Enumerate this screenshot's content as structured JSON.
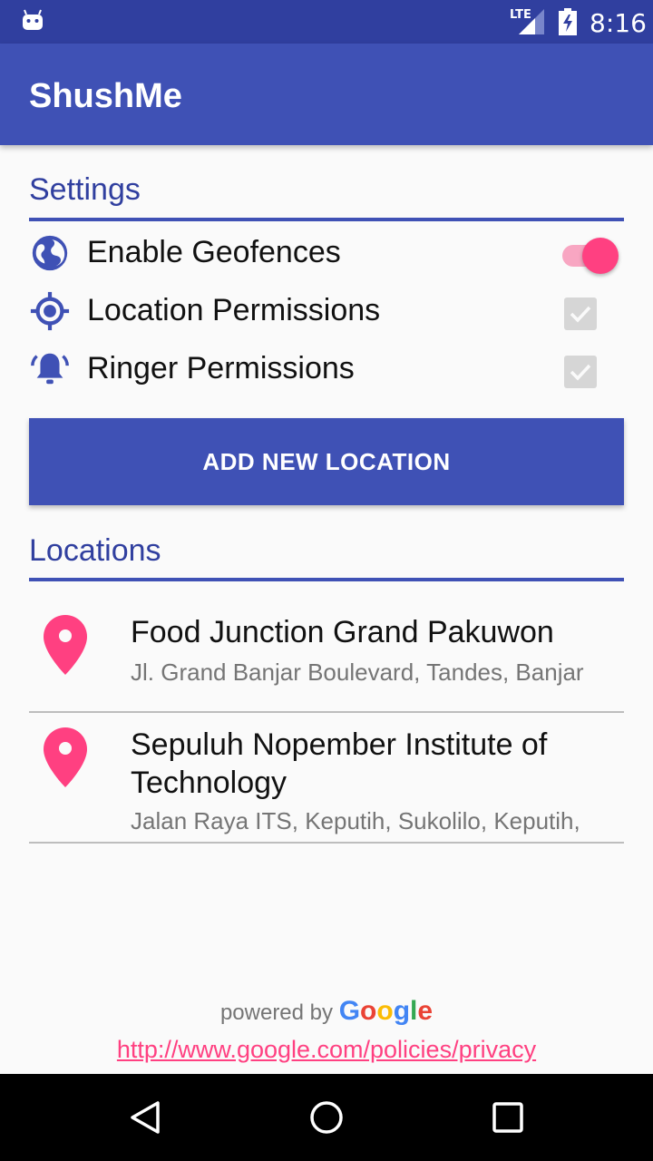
{
  "status_bar": {
    "network_label": "LTE",
    "time": "8:16",
    "icons": [
      "android-icon",
      "signal-icon",
      "battery-charging-icon"
    ]
  },
  "app_bar": {
    "title": "ShushMe"
  },
  "settings": {
    "header": "Settings",
    "items": [
      {
        "label": "Enable Geofences",
        "icon": "globe-icon",
        "control": "switch",
        "checked": true
      },
      {
        "label": "Location Permissions",
        "icon": "gps-target-icon",
        "control": "checkbox",
        "checked": true,
        "disabled": true
      },
      {
        "label": "Ringer Permissions",
        "icon": "bell-ringing-icon",
        "control": "checkbox",
        "checked": true,
        "disabled": true
      }
    ]
  },
  "add_button": {
    "label": "ADD NEW LOCATION"
  },
  "locations": {
    "header": "Locations",
    "items": [
      {
        "name": "Food Junction Grand Pakuwon",
        "address": "Jl. Grand Banjar Boulevard, Tandes, Banjar",
        "icon": "map-pin-icon"
      },
      {
        "name": "Sepuluh Nopember Institute of Technology",
        "address": "Jalan Raya ITS, Keputih, Sukolilo, Keputih,",
        "icon": "map-pin-icon"
      }
    ]
  },
  "footer": {
    "powered_by": "powered by",
    "brand": "Google",
    "privacy_url": "http://www.google.com/policies/privacy"
  },
  "colors": {
    "primary": "#3f51b5",
    "primary_dark": "#303f9f",
    "accent": "#ff4081"
  },
  "nav_bar": {
    "icons": [
      "back-icon",
      "home-icon",
      "recents-icon"
    ]
  }
}
